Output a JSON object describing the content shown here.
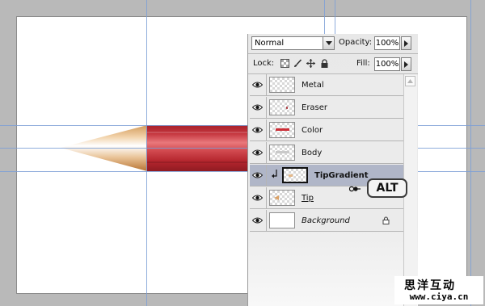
{
  "layers_panel": {
    "blend_mode": "Normal",
    "opacity_label": "Opacity:",
    "opacity_value": "100%",
    "lock_label": "Lock:",
    "fill_label": "Fill:",
    "fill_value": "100%",
    "layers": [
      {
        "name": "Metal",
        "visible": true,
        "selected": false,
        "thumb": "transparent"
      },
      {
        "name": "Eraser",
        "visible": true,
        "selected": false,
        "thumb": "transparent-dot"
      },
      {
        "name": "Color",
        "visible": true,
        "selected": false,
        "thumb": "red-stripe"
      },
      {
        "name": "Body",
        "visible": true,
        "selected": false,
        "thumb": "transparent-gray"
      },
      {
        "name": "TipGradient",
        "visible": true,
        "selected": true,
        "thumb": "transparent",
        "clipped": true
      },
      {
        "name": "Tip",
        "visible": true,
        "selected": false,
        "thumb": "transparent-orange"
      },
      {
        "name": "Background",
        "visible": true,
        "selected": false,
        "thumb": "white",
        "locked": true
      }
    ]
  },
  "hint_badge": "ALT",
  "watermark": {
    "line1": "思洋互动",
    "line2": "www.ciya.cn"
  },
  "colors": {
    "pencil_red": "#c4343d",
    "tip_wood": "#d9a56b",
    "guide": "#7d9fd6",
    "selection": "#b0b6c8"
  }
}
